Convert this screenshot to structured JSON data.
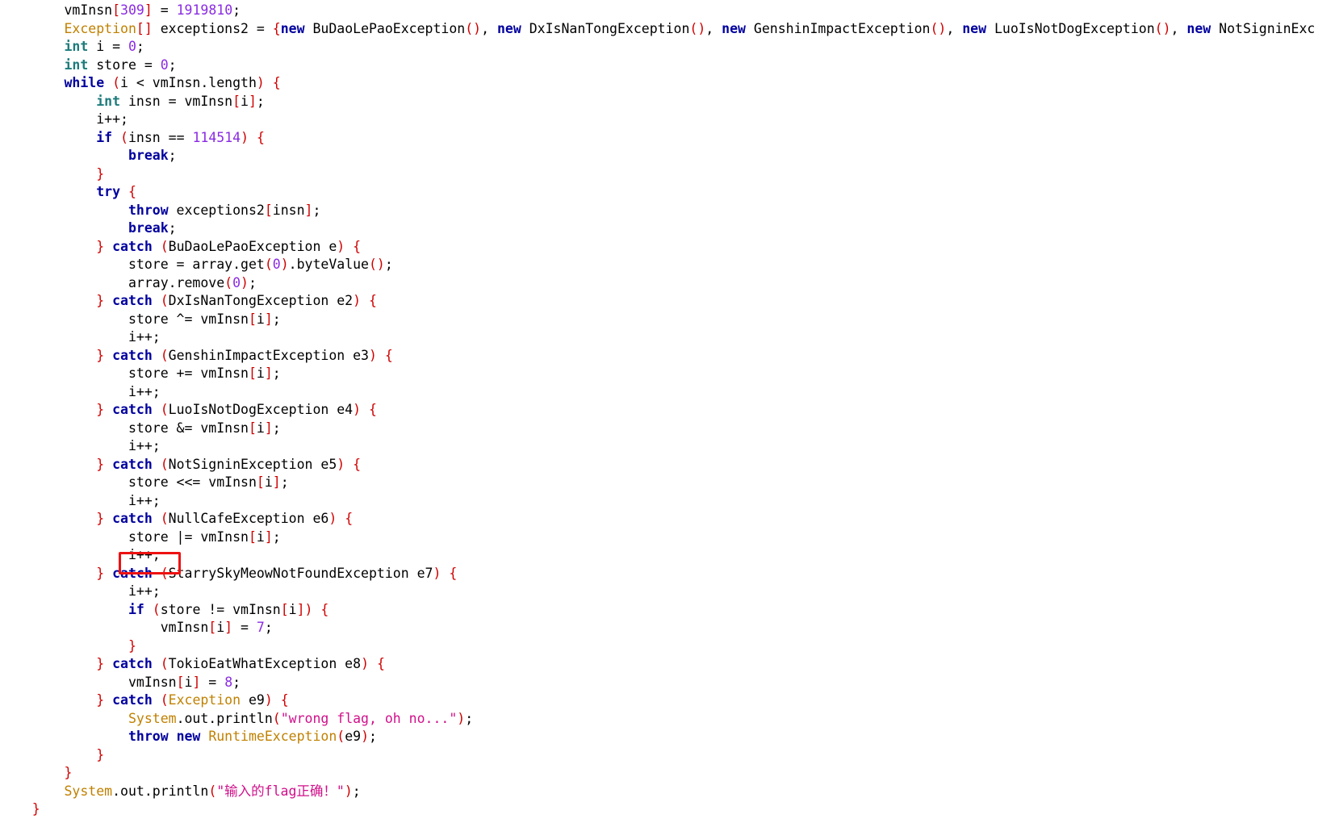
{
  "editor": {
    "indent_unit": "    ",
    "token_colors": {
      "keyword": "#00009e",
      "type": "#1d7b7b",
      "class": "#c08000",
      "number": "#8a2be2",
      "string": "#d0108a",
      "punct": "#d00000",
      "ident": "#000000",
      "highlight": "#ee1111"
    },
    "lines": [
      {
        "indent": 2,
        "tokens": [
          [
            "vmInsn",
            "id"
          ],
          [
            "[",
            "pun"
          ],
          [
            "309",
            "num"
          ],
          [
            "]",
            "pun"
          ],
          [
            " = ",
            "id"
          ],
          [
            "1919810",
            "num"
          ],
          [
            ";",
            "id"
          ]
        ]
      },
      {
        "indent": 2,
        "tokens": [
          [
            "Exception",
            "cls"
          ],
          [
            "[]",
            "pun"
          ],
          [
            " exceptions2 = ",
            "id"
          ],
          [
            "{",
            "pun"
          ],
          [
            "new",
            "kw"
          ],
          [
            " BuDaoLePaoException",
            "id"
          ],
          [
            "()",
            "pun"
          ],
          [
            ", ",
            "id"
          ],
          [
            "new",
            "kw"
          ],
          [
            " DxIsNanTongException",
            "id"
          ],
          [
            "()",
            "pun"
          ],
          [
            ", ",
            "id"
          ],
          [
            "new",
            "kw"
          ],
          [
            " GenshinImpactException",
            "id"
          ],
          [
            "()",
            "pun"
          ],
          [
            ", ",
            "id"
          ],
          [
            "new",
            "kw"
          ],
          [
            " LuoIsNotDogException",
            "id"
          ],
          [
            "()",
            "pun"
          ],
          [
            ", ",
            "id"
          ],
          [
            "new",
            "kw"
          ],
          [
            " NotSigninExc",
            "id"
          ]
        ]
      },
      {
        "indent": 2,
        "tokens": [
          [
            "int",
            "typ"
          ],
          [
            " i = ",
            "id"
          ],
          [
            "0",
            "num"
          ],
          [
            ";",
            "id"
          ]
        ]
      },
      {
        "indent": 2,
        "tokens": [
          [
            "int",
            "typ"
          ],
          [
            " store = ",
            "id"
          ],
          [
            "0",
            "num"
          ],
          [
            ";",
            "id"
          ]
        ]
      },
      {
        "indent": 2,
        "tokens": [
          [
            "while",
            "kw"
          ],
          [
            " ",
            "id"
          ],
          [
            "(",
            "pun"
          ],
          [
            "i < vmInsn.length",
            "id"
          ],
          [
            ")",
            "pun"
          ],
          [
            " ",
            "id"
          ],
          [
            "{",
            "pun"
          ]
        ]
      },
      {
        "indent": 3,
        "tokens": [
          [
            "int",
            "typ"
          ],
          [
            " insn = vmInsn",
            "id"
          ],
          [
            "[",
            "pun"
          ],
          [
            "i",
            "id"
          ],
          [
            "]",
            "pun"
          ],
          [
            ";",
            "id"
          ]
        ]
      },
      {
        "indent": 3,
        "tokens": [
          [
            "i++;",
            "id"
          ]
        ]
      },
      {
        "indent": 3,
        "tokens": [
          [
            "if",
            "kw"
          ],
          [
            " ",
            "id"
          ],
          [
            "(",
            "pun"
          ],
          [
            "insn == ",
            "id"
          ],
          [
            "114514",
            "num"
          ],
          [
            ")",
            "pun"
          ],
          [
            " ",
            "id"
          ],
          [
            "{",
            "pun"
          ]
        ]
      },
      {
        "indent": 4,
        "tokens": [
          [
            "break",
            "kw"
          ],
          [
            ";",
            "id"
          ]
        ]
      },
      {
        "indent": 3,
        "tokens": [
          [
            "}",
            "pun"
          ]
        ]
      },
      {
        "indent": 3,
        "tokens": [
          [
            "try",
            "kw"
          ],
          [
            " ",
            "id"
          ],
          [
            "{",
            "pun"
          ]
        ]
      },
      {
        "indent": 4,
        "tokens": [
          [
            "throw",
            "kw"
          ],
          [
            " exceptions2",
            "id"
          ],
          [
            "[",
            "pun"
          ],
          [
            "insn",
            "id"
          ],
          [
            "]",
            "pun"
          ],
          [
            ";",
            "id"
          ]
        ]
      },
      {
        "indent": 4,
        "tokens": [
          [
            "break",
            "kw"
          ],
          [
            ";",
            "id"
          ]
        ]
      },
      {
        "indent": 3,
        "tokens": [
          [
            "}",
            "pun"
          ],
          [
            " ",
            "id"
          ],
          [
            "catch",
            "kw"
          ],
          [
            " ",
            "id"
          ],
          [
            "(",
            "pun"
          ],
          [
            "BuDaoLePaoException e",
            "id"
          ],
          [
            ")",
            "pun"
          ],
          [
            " ",
            "id"
          ],
          [
            "{",
            "pun"
          ]
        ]
      },
      {
        "indent": 4,
        "tokens": [
          [
            "store = array.get",
            "id"
          ],
          [
            "(",
            "pun"
          ],
          [
            "0",
            "num"
          ],
          [
            ")",
            "pun"
          ],
          [
            ".byteValue",
            "id"
          ],
          [
            "()",
            "pun"
          ],
          [
            ";",
            "id"
          ]
        ]
      },
      {
        "indent": 4,
        "tokens": [
          [
            "array.remove",
            "id"
          ],
          [
            "(",
            "pun"
          ],
          [
            "0",
            "num"
          ],
          [
            ")",
            "pun"
          ],
          [
            ";",
            "id"
          ]
        ]
      },
      {
        "indent": 3,
        "tokens": [
          [
            "}",
            "pun"
          ],
          [
            " ",
            "id"
          ],
          [
            "catch",
            "kw"
          ],
          [
            " ",
            "id"
          ],
          [
            "(",
            "pun"
          ],
          [
            "DxIsNanTongException e2",
            "id"
          ],
          [
            ")",
            "pun"
          ],
          [
            " ",
            "id"
          ],
          [
            "{",
            "pun"
          ]
        ]
      },
      {
        "indent": 4,
        "tokens": [
          [
            "store ^= vmInsn",
            "id"
          ],
          [
            "[",
            "pun"
          ],
          [
            "i",
            "id"
          ],
          [
            "]",
            "pun"
          ],
          [
            ";",
            "id"
          ]
        ]
      },
      {
        "indent": 4,
        "tokens": [
          [
            "i++;",
            "id"
          ]
        ]
      },
      {
        "indent": 3,
        "tokens": [
          [
            "}",
            "pun"
          ],
          [
            " ",
            "id"
          ],
          [
            "catch",
            "kw"
          ],
          [
            " ",
            "id"
          ],
          [
            "(",
            "pun"
          ],
          [
            "GenshinImpactException e3",
            "id"
          ],
          [
            ")",
            "pun"
          ],
          [
            " ",
            "id"
          ],
          [
            "{",
            "pun"
          ]
        ]
      },
      {
        "indent": 4,
        "tokens": [
          [
            "store += vmInsn",
            "id"
          ],
          [
            "[",
            "pun"
          ],
          [
            "i",
            "id"
          ],
          [
            "]",
            "pun"
          ],
          [
            ";",
            "id"
          ]
        ]
      },
      {
        "indent": 4,
        "tokens": [
          [
            "i++;",
            "id"
          ]
        ]
      },
      {
        "indent": 3,
        "tokens": [
          [
            "}",
            "pun"
          ],
          [
            " ",
            "id"
          ],
          [
            "catch",
            "kw"
          ],
          [
            " ",
            "id"
          ],
          [
            "(",
            "pun"
          ],
          [
            "LuoIsNotDogException e4",
            "id"
          ],
          [
            ")",
            "pun"
          ],
          [
            " ",
            "id"
          ],
          [
            "{",
            "pun"
          ]
        ]
      },
      {
        "indent": 4,
        "tokens": [
          [
            "store &= vmInsn",
            "id"
          ],
          [
            "[",
            "pun"
          ],
          [
            "i",
            "id"
          ],
          [
            "]",
            "pun"
          ],
          [
            ";",
            "id"
          ]
        ]
      },
      {
        "indent": 4,
        "tokens": [
          [
            "i++;",
            "id"
          ]
        ]
      },
      {
        "indent": 3,
        "tokens": [
          [
            "}",
            "pun"
          ],
          [
            " ",
            "id"
          ],
          [
            "catch",
            "kw"
          ],
          [
            " ",
            "id"
          ],
          [
            "(",
            "pun"
          ],
          [
            "NotSigninException e5",
            "id"
          ],
          [
            ")",
            "pun"
          ],
          [
            " ",
            "id"
          ],
          [
            "{",
            "pun"
          ]
        ]
      },
      {
        "indent": 4,
        "tokens": [
          [
            "store <<= vmInsn",
            "id"
          ],
          [
            "[",
            "pun"
          ],
          [
            "i",
            "id"
          ],
          [
            "]",
            "pun"
          ],
          [
            ";",
            "id"
          ]
        ]
      },
      {
        "indent": 4,
        "tokens": [
          [
            "i++;",
            "id"
          ]
        ]
      },
      {
        "indent": 3,
        "tokens": [
          [
            "}",
            "pun"
          ],
          [
            " ",
            "id"
          ],
          [
            "catch",
            "kw"
          ],
          [
            " ",
            "id"
          ],
          [
            "(",
            "pun"
          ],
          [
            "NullCafeException e6",
            "id"
          ],
          [
            ")",
            "pun"
          ],
          [
            " ",
            "id"
          ],
          [
            "{",
            "pun"
          ]
        ]
      },
      {
        "indent": 4,
        "tokens": [
          [
            "store |= vmInsn",
            "id"
          ],
          [
            "[",
            "pun"
          ],
          [
            "i",
            "id"
          ],
          [
            "]",
            "pun"
          ],
          [
            ";",
            "id"
          ]
        ]
      },
      {
        "indent": 4,
        "tokens": [
          [
            "i++;",
            "id"
          ]
        ]
      },
      {
        "indent": 3,
        "tokens": [
          [
            "}",
            "pun"
          ],
          [
            " ",
            "id"
          ],
          [
            "catch",
            "kw"
          ],
          [
            " ",
            "id"
          ],
          [
            "(",
            "pun"
          ],
          [
            "StarrySkyMeowNotFoundException e7",
            "id"
          ],
          [
            ")",
            "pun"
          ],
          [
            " ",
            "id"
          ],
          [
            "{",
            "pun"
          ]
        ]
      },
      {
        "indent": 4,
        "tokens": [
          [
            "i++;",
            "id"
          ]
        ]
      },
      {
        "indent": 4,
        "tokens": [
          [
            "if",
            "kw"
          ],
          [
            " ",
            "id"
          ],
          [
            "(",
            "pun"
          ],
          [
            "store != vmInsn",
            "id"
          ],
          [
            "[",
            "pun"
          ],
          [
            "i",
            "id"
          ],
          [
            "]",
            "pun"
          ],
          [
            ")",
            "pun"
          ],
          [
            " ",
            "id"
          ],
          [
            "{",
            "pun"
          ]
        ]
      },
      {
        "indent": 5,
        "tokens": [
          [
            "vmInsn",
            "id"
          ],
          [
            "[",
            "pun"
          ],
          [
            "i",
            "id"
          ],
          [
            "]",
            "pun"
          ],
          [
            " = ",
            "id"
          ],
          [
            "7",
            "num"
          ],
          [
            ";",
            "id"
          ]
        ]
      },
      {
        "indent": 4,
        "tokens": [
          [
            "}",
            "pun"
          ]
        ]
      },
      {
        "indent": 3,
        "tokens": [
          [
            "}",
            "pun"
          ],
          [
            " ",
            "id"
          ],
          [
            "catch",
            "kw"
          ],
          [
            " ",
            "id"
          ],
          [
            "(",
            "pun"
          ],
          [
            "TokioEatWhatException e8",
            "id"
          ],
          [
            ")",
            "pun"
          ],
          [
            " ",
            "id"
          ],
          [
            "{",
            "pun"
          ]
        ]
      },
      {
        "indent": 4,
        "tokens": [
          [
            "vmInsn",
            "id"
          ],
          [
            "[",
            "pun"
          ],
          [
            "i",
            "id"
          ],
          [
            "]",
            "pun"
          ],
          [
            " = ",
            "id"
          ],
          [
            "8",
            "num"
          ],
          [
            ";",
            "id"
          ]
        ]
      },
      {
        "indent": 3,
        "tokens": [
          [
            "}",
            "pun"
          ],
          [
            " ",
            "id"
          ],
          [
            "catch",
            "kw"
          ],
          [
            " ",
            "id"
          ],
          [
            "(",
            "pun"
          ],
          [
            "Exception",
            "cls"
          ],
          [
            " e9",
            "id"
          ],
          [
            ")",
            "pun"
          ],
          [
            " ",
            "id"
          ],
          [
            "{",
            "pun"
          ]
        ]
      },
      {
        "indent": 4,
        "tokens": [
          [
            "System",
            "cls"
          ],
          [
            ".out.println",
            "id"
          ],
          [
            "(",
            "pun"
          ],
          [
            "\"wrong flag, oh no...\"",
            "str"
          ],
          [
            ")",
            "pun"
          ],
          [
            ";",
            "id"
          ]
        ]
      },
      {
        "indent": 4,
        "tokens": [
          [
            "throw",
            "kw"
          ],
          [
            " ",
            "id"
          ],
          [
            "new",
            "kw"
          ],
          [
            " ",
            "id"
          ],
          [
            "RuntimeException",
            "cls"
          ],
          [
            "(",
            "pun"
          ],
          [
            "e9",
            "id"
          ],
          [
            ")",
            "pun"
          ],
          [
            ";",
            "id"
          ]
        ]
      },
      {
        "indent": 3,
        "tokens": [
          [
            "}",
            "pun"
          ]
        ]
      },
      {
        "indent": 2,
        "tokens": [
          [
            "}",
            "pun"
          ]
        ]
      },
      {
        "indent": 2,
        "tokens": [
          [
            "System",
            "cls"
          ],
          [
            ".out.println",
            "id"
          ],
          [
            "(",
            "pun"
          ],
          [
            "\"输入的flag正确！\"",
            "str"
          ],
          [
            ")",
            "pun"
          ],
          [
            ";",
            "id"
          ]
        ]
      },
      {
        "indent": 1,
        "tokens": [
          [
            "}",
            "pun"
          ]
        ]
      }
    ],
    "highlight": {
      "line_index": 32,
      "text": "i++;"
    }
  }
}
